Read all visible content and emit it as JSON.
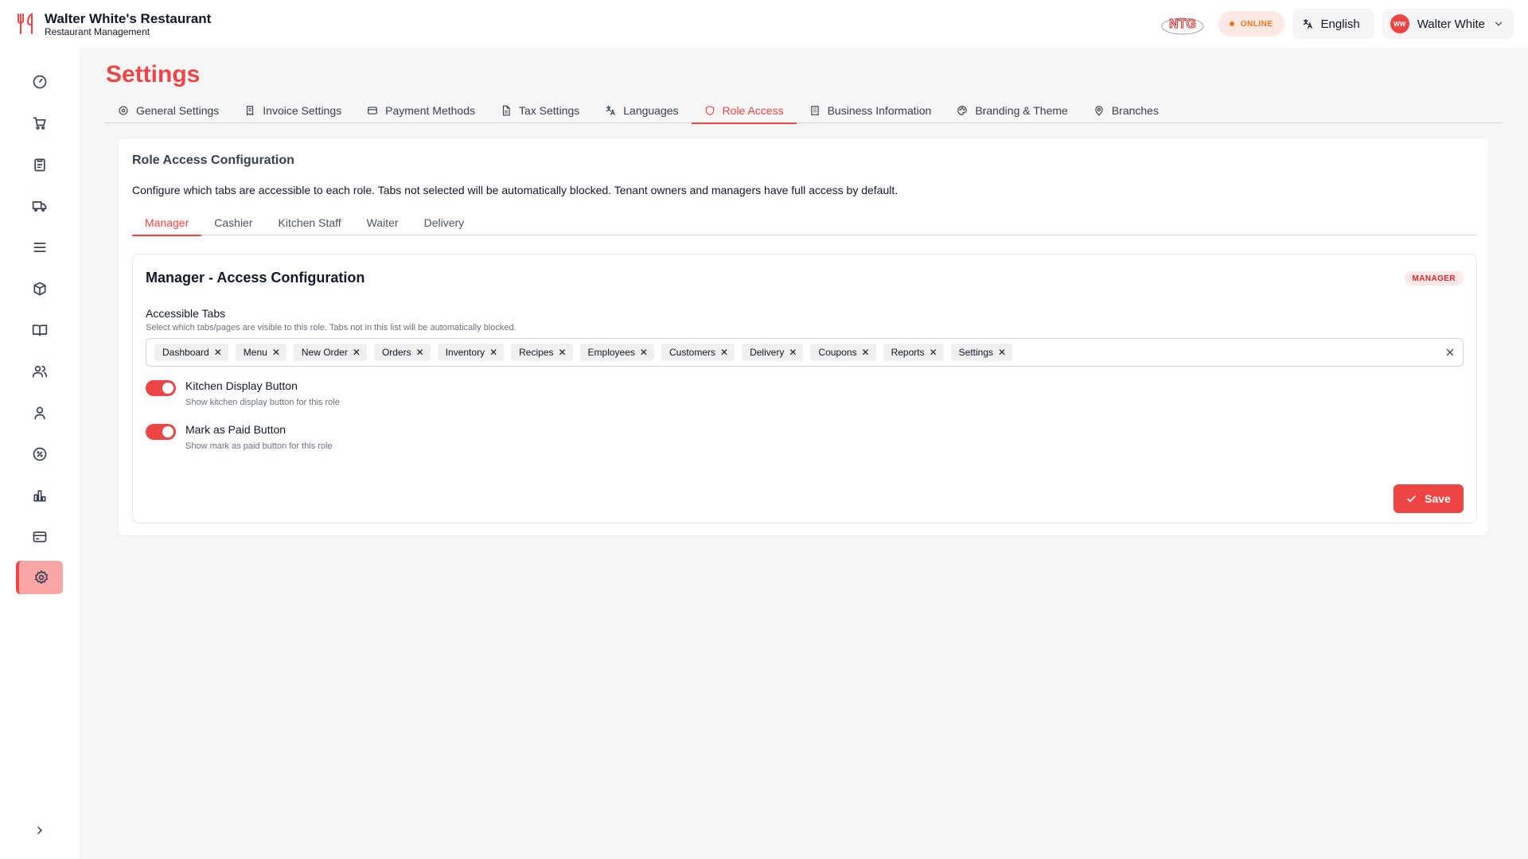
{
  "brand": {
    "title": "Walter White's Restaurant",
    "subtitle": "Restaurant Management",
    "logo_text": "NTG"
  },
  "header": {
    "status": "ONLINE",
    "language": "English",
    "user_initials": "WW",
    "user_name": "Walter White"
  },
  "sidebar": {
    "items": [
      {
        "icon": "dashboard-gauge-icon"
      },
      {
        "icon": "cart-icon"
      },
      {
        "icon": "clipboard-icon"
      },
      {
        "icon": "truck-icon"
      },
      {
        "icon": "menu-lines-icon"
      },
      {
        "icon": "box-icon"
      },
      {
        "icon": "book-icon"
      },
      {
        "icon": "users-icon"
      },
      {
        "icon": "user-icon"
      },
      {
        "icon": "percent-badge-icon"
      },
      {
        "icon": "bar-chart-icon"
      },
      {
        "icon": "credit-card-icon"
      },
      {
        "icon": "gear-icon",
        "active": true
      }
    ]
  },
  "page": {
    "title": "Settings",
    "tabs": [
      {
        "label": "General Settings",
        "icon": "gear-icon"
      },
      {
        "label": "Invoice Settings",
        "icon": "receipt-icon"
      },
      {
        "label": "Payment Methods",
        "icon": "credit-card-icon"
      },
      {
        "label": "Tax Settings",
        "icon": "file-icon"
      },
      {
        "label": "Languages",
        "icon": "translate-icon"
      },
      {
        "label": "Role Access",
        "icon": "shield-icon",
        "active": true
      },
      {
        "label": "Business Information",
        "icon": "building-icon"
      },
      {
        "label": "Branding & Theme",
        "icon": "palette-icon"
      },
      {
        "label": "Branches",
        "icon": "map-pin-icon"
      }
    ]
  },
  "role_access": {
    "title": "Role Access Configuration",
    "description": "Configure which tabs are accessible to each role. Tabs not selected will be automatically blocked. Tenant owners and managers have full access by default.",
    "roles": [
      "Manager",
      "Cashier",
      "Kitchen Staff",
      "Waiter",
      "Delivery"
    ],
    "active_role": "Manager",
    "config": {
      "title": "Manager - Access Configuration",
      "badge": "MANAGER",
      "accessible_label": "Accessible Tabs",
      "accessible_help": "Select which tabs/pages are visible to this role. Tabs not in this list will be automatically blocked.",
      "tags": [
        "Dashboard",
        "Menu",
        "New Order",
        "Orders",
        "Inventory",
        "Recipes",
        "Employees",
        "Customers",
        "Delivery",
        "Coupons",
        "Reports",
        "Settings"
      ],
      "toggles": [
        {
          "label": "Kitchen Display Button",
          "help": "Show kitchen display button for this role",
          "on": true
        },
        {
          "label": "Mark as Paid Button",
          "help": "Show mark as paid button for this role",
          "on": true
        }
      ],
      "save_label": "Save"
    }
  },
  "colors": {
    "accent": "#ef4444",
    "active_sidebar_bg": "#fca5a5",
    "online": "#f97316"
  }
}
